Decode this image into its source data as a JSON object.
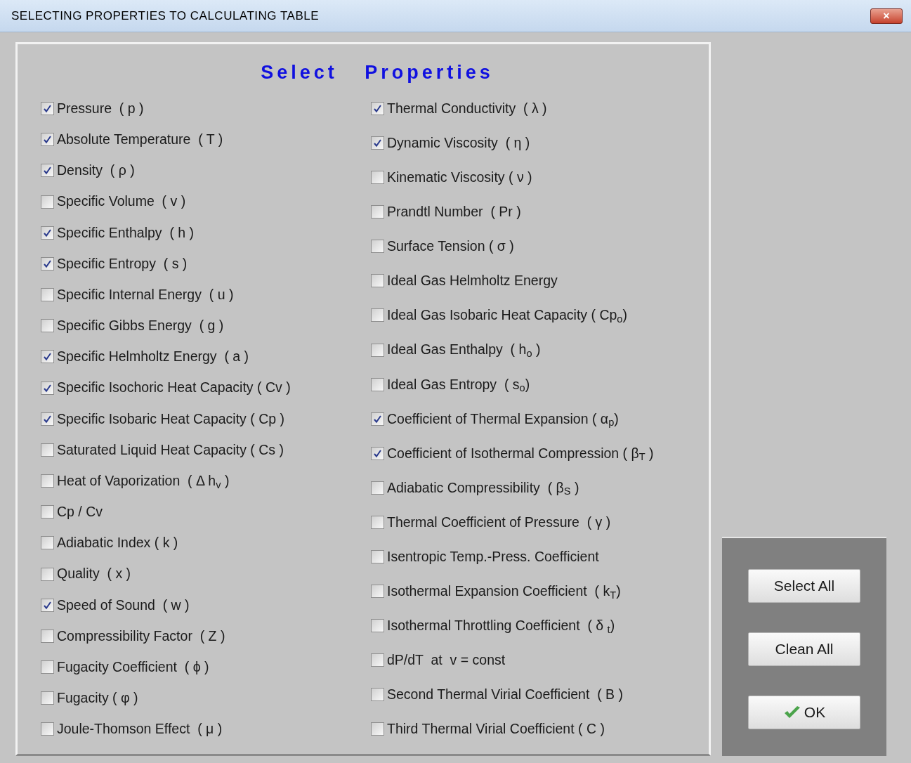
{
  "window": {
    "title": "SELECTING PROPERTIES TO CALCULATING TABLE",
    "close": "×"
  },
  "heading": "Select Properties",
  "columns": [
    {
      "items": [
        {
          "label": "Pressure  ( p )",
          "checked": true
        },
        {
          "label": "Absolute Temperature  ( T )",
          "checked": true
        },
        {
          "label": "Density  ( ρ )",
          "checked": true
        },
        {
          "label": "Specific Volume  ( v )",
          "checked": false
        },
        {
          "label": "Specific Enthalpy  ( h )",
          "checked": true
        },
        {
          "label": "Specific Entropy  ( s )",
          "checked": true
        },
        {
          "label": "Specific Internal Energy  ( u )",
          "checked": false
        },
        {
          "label": "Specific Gibbs Energy  ( g )",
          "checked": false
        },
        {
          "label": "Specific Helmholtz Energy  ( a )",
          "checked": true
        },
        {
          "label": "Specific Isochoric Heat Capacity ( Cv )",
          "checked": true
        },
        {
          "label": "Specific Isobaric Heat Capacity ( Cp )",
          "checked": true
        },
        {
          "label": "Saturated Liquid Heat Capacity ( Cs )",
          "checked": false
        },
        {
          "label": "Heat of Vaporization  ( Δ h$_{v}$ )",
          "checked": false
        },
        {
          "label": "Cp / Cv",
          "checked": false
        },
        {
          "label": "Adiabatic Index ( k )",
          "checked": false
        },
        {
          "label": "Quality  ( x )",
          "checked": false
        },
        {
          "label": "Speed of Sound  ( w )",
          "checked": true
        },
        {
          "label": "Compressibility Factor  ( Z )",
          "checked": false
        },
        {
          "label": "Fugacity Coefficient  ( ϕ )",
          "checked": false
        },
        {
          "label": "Fugacity ( φ )",
          "checked": false
        },
        {
          "label": "Joule-Thomson Effect  ( μ )",
          "checked": false
        }
      ]
    },
    {
      "items": [
        {
          "label": "Thermal Conductivity  ( λ )",
          "checked": true
        },
        {
          "label": "Dynamic Viscosity  ( η )",
          "checked": true
        },
        {
          "label": "Kinematic Viscosity ( ν )",
          "checked": false
        },
        {
          "label": "Prandtl Number  ( Pr )",
          "checked": false
        },
        {
          "label": "Surface Tension ( σ )",
          "checked": false
        },
        {
          "label": "Ideal Gas Helmholtz Energy",
          "checked": false
        },
        {
          "label": "Ideal Gas Isobaric Heat Capacity ( Cp$_{o}$)",
          "checked": false
        },
        {
          "label": "Ideal Gas Enthalpy  ( h$_{o}$ )",
          "checked": false
        },
        {
          "label": "Ideal Gas Entropy  ( s$_{o}$)",
          "checked": false
        },
        {
          "label": "Coefficient of Thermal Expansion ( α$_{p}$)",
          "checked": true
        },
        {
          "label": "Coefficient of Isothermal Compression ( β$_{T}$ )",
          "checked": true
        },
        {
          "label": "Adiabatic Compressibility  ( β$_{S}$ )",
          "checked": false
        },
        {
          "label": "Thermal Coefficient of Pressure  ( γ )",
          "checked": false
        },
        {
          "label": "Isentropic Temp.-Press. Coefficient",
          "checked": false
        },
        {
          "label": "Isothermal Expansion Coefficient  ( k$_{T}$)",
          "checked": false
        },
        {
          "label": "Isothermal Throttling Coefficient  ( δ $_{t}$)",
          "checked": false
        },
        {
          "label": "dP/dT  at  v = const",
          "checked": false
        },
        {
          "label": "Second Thermal Virial Coefficient  ( B )",
          "checked": false
        },
        {
          "label": "Third Thermal Virial Coefficient ( C )",
          "checked": false
        }
      ]
    }
  ],
  "buttons": [
    {
      "label": "Select All",
      "kind": "plain"
    },
    {
      "label": "Clean All",
      "kind": "plain"
    },
    {
      "label": "OK",
      "kind": "ok"
    }
  ]
}
